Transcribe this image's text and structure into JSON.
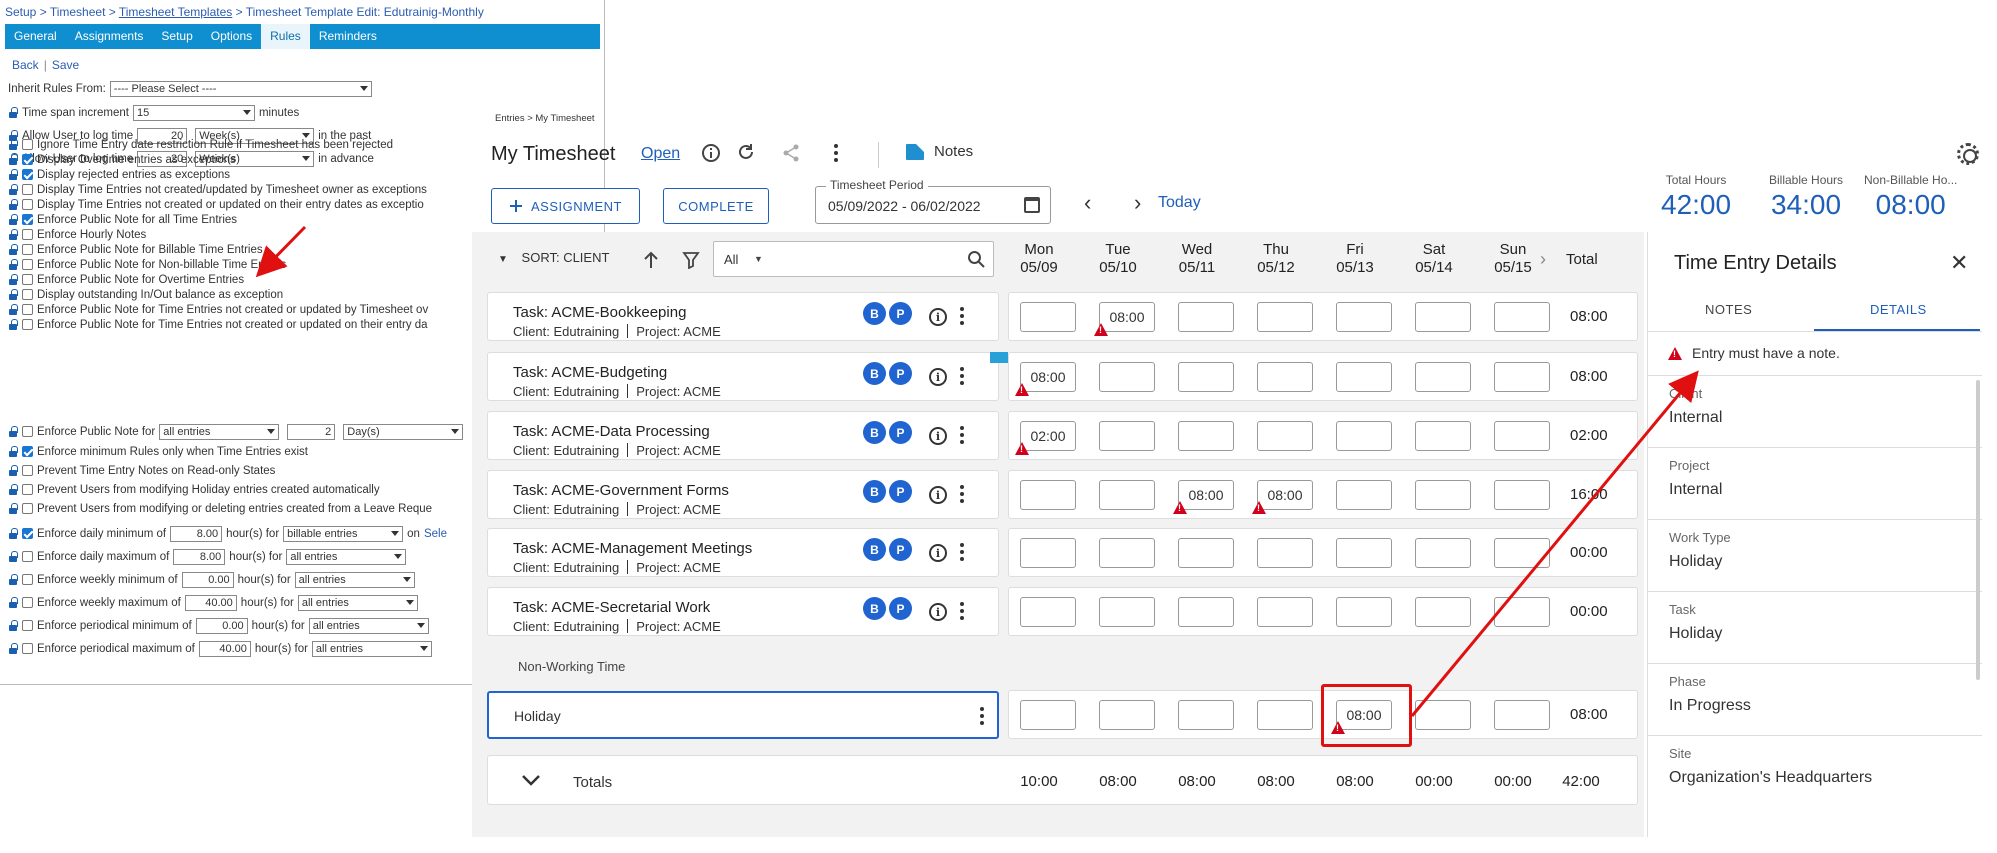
{
  "legacy": {
    "breadcrumb": {
      "setup": "Setup",
      "timesheet": "Timesheet",
      "templates": "Timesheet Templates",
      "edit": "Timesheet Template Edit: Edutrainig-Monthly"
    },
    "tabs": [
      "General",
      "Assignments",
      "Setup",
      "Options",
      "Rules",
      "Reminders"
    ],
    "active_tab": "Rules",
    "back": "Back",
    "save": "Save",
    "inherit_label": "Inherit Rules From:",
    "inherit_value": "---- Please Select ----",
    "span_label": "Time span increment",
    "span_value": "15",
    "span_unit": "minutes",
    "past_label": "Allow User to log time",
    "past_value": "20",
    "past_unit": "Week(s)",
    "past_suffix": "in the past",
    "adv_label": "Allow User to log time",
    "adv_value": "20",
    "adv_unit": "Week(s)",
    "adv_suffix": "in advance",
    "rules": [
      {
        "text": "Ignore Time Entry date restriction Rule if Timesheet has been rejected",
        "checked": false
      },
      {
        "text": "Display Overtime entries as exceptions",
        "checked": true
      },
      {
        "text": "Display rejected entries as exceptions",
        "checked": true
      },
      {
        "text": "Display Time Entries not created/updated by Timesheet owner as exceptions",
        "checked": false
      },
      {
        "text": "Display Time Entries not created or updated on their entry dates as exceptio",
        "checked": false
      },
      {
        "text": "Enforce Public Note for all Time Entries",
        "checked": true
      },
      {
        "text": "Enforce Hourly Notes",
        "checked": false
      },
      {
        "text": "Enforce Public Note for Billable Time Entries",
        "checked": false
      },
      {
        "text": "Enforce Public Note for Non-billable Time Entries",
        "checked": false
      },
      {
        "text": "Enforce Public Note for Overtime Entries",
        "checked": false
      },
      {
        "text": "Display outstanding In/Out balance as exception",
        "checked": false
      },
      {
        "text": "Enforce Public Note for Time Entries not created or updated by Timesheet ov",
        "checked": false
      },
      {
        "text": "Enforce Public Note for Time Entries not created or updated on their entry da",
        "checked": false
      }
    ],
    "note_for_label": "Enforce Public Note for",
    "note_for_value": "all entries",
    "note_for_num": "2",
    "note_for_unit": "Day(s)",
    "rules2": [
      {
        "text": "Enforce minimum Rules only when Time Entries exist",
        "checked": true
      },
      {
        "text": "Prevent Time Entry Notes on Read-only States",
        "checked": false
      },
      {
        "text": "Prevent Users from modifying Holiday entries created automatically",
        "checked": false
      },
      {
        "text": "Prevent Users from modifying or deleting entries created from a Leave Reque",
        "checked": false
      }
    ],
    "limits": [
      {
        "label": "Enforce daily minimum of",
        "value": "8.00",
        "unit": "hour(s) for",
        "sel": "billable entries",
        "checked": true,
        "suffix": "on",
        "link": "Sele"
      },
      {
        "label": "Enforce daily maximum of",
        "value": "8.00",
        "unit": "hour(s) for",
        "sel": "all entries",
        "checked": false,
        "suffix": "",
        "link": ""
      },
      {
        "label": "Enforce weekly minimum of",
        "value": "0.00",
        "unit": "hour(s) for",
        "sel": "all entries",
        "checked": false,
        "suffix": "",
        "link": ""
      },
      {
        "label": "Enforce weekly maximum of",
        "value": "40.00",
        "unit": "hour(s) for",
        "sel": "all entries",
        "checked": false,
        "suffix": "",
        "link": ""
      },
      {
        "label": "Enforce periodical minimum of",
        "value": "0.00",
        "unit": "hour(s) for",
        "sel": "all entries",
        "checked": false,
        "suffix": "",
        "link": ""
      },
      {
        "label": "Enforce periodical maximum of",
        "value": "40.00",
        "unit": "hour(s) for",
        "sel": "all entries",
        "checked": false,
        "suffix": "",
        "link": ""
      }
    ]
  },
  "timesheet": {
    "breadcrumb": "Entries > My Timesheet",
    "title": "My Timesheet",
    "status": "Open",
    "notes": "Notes",
    "assignment_btn": "ASSIGNMENT",
    "complete_btn": "COMPLETE",
    "period_label": "Timesheet Period",
    "period_value": "05/09/2022 - 06/02/2022",
    "today": "Today",
    "stats": [
      {
        "label": "Total Hours",
        "value": "42:00"
      },
      {
        "label": "Billable Hours",
        "value": "34:00"
      },
      {
        "label": "Non-Billable Ho...",
        "value": "08:00"
      }
    ],
    "sort_label": "SORT: CLIENT",
    "filter_value": "All",
    "days": [
      {
        "name": "Mon",
        "date": "05/09"
      },
      {
        "name": "Tue",
        "date": "05/10"
      },
      {
        "name": "Wed",
        "date": "05/11"
      },
      {
        "name": "Thu",
        "date": "05/12"
      },
      {
        "name": "Fri",
        "date": "05/13"
      },
      {
        "name": "Sat",
        "date": "05/14"
      },
      {
        "name": "Sun",
        "date": "05/15"
      }
    ],
    "total_label": "Total",
    "client_prefix": "Client: Edutraining",
    "project_prefix": "Project: ACME",
    "badge_b": "B",
    "badge_p": "P",
    "tasks": [
      {
        "name": "Task: ACME-Bookkeeping",
        "cells": [
          "",
          "08:00",
          "",
          "",
          "",
          "",
          ""
        ],
        "warn": [
          false,
          true,
          false,
          false,
          false,
          false,
          false
        ],
        "total": "08:00"
      },
      {
        "name": "Task: ACME-Budgeting",
        "cells": [
          "08:00",
          "",
          "",
          "",
          "",
          "",
          ""
        ],
        "warn": [
          true,
          false,
          false,
          false,
          false,
          false,
          false
        ],
        "total": "08:00"
      },
      {
        "name": "Task: ACME-Data Processing",
        "cells": [
          "02:00",
          "",
          "",
          "",
          "",
          "",
          ""
        ],
        "warn": [
          true,
          false,
          false,
          false,
          false,
          false,
          false
        ],
        "total": "02:00"
      },
      {
        "name": "Task: ACME-Government Forms",
        "cells": [
          "",
          "",
          "08:00",
          "08:00",
          "",
          "",
          ""
        ],
        "warn": [
          false,
          false,
          true,
          true,
          false,
          false,
          false
        ],
        "total": "16:00"
      },
      {
        "name": "Task: ACME-Management Meetings",
        "cells": [
          "",
          "",
          "",
          "",
          "",
          "",
          ""
        ],
        "warn": [
          false,
          false,
          false,
          false,
          false,
          false,
          false
        ],
        "total": "00:00"
      },
      {
        "name": "Task: ACME-Secretarial Work",
        "cells": [
          "",
          "",
          "",
          "",
          "",
          "",
          ""
        ],
        "warn": [
          false,
          false,
          false,
          false,
          false,
          false,
          false
        ],
        "total": "00:00"
      }
    ],
    "non_working": "Non-Working Time",
    "holiday": {
      "name": "Holiday",
      "cells": [
        "",
        "",
        "",
        "",
        "08:00",
        "",
        ""
      ],
      "warn": [
        false,
        false,
        false,
        false,
        true,
        false,
        false
      ],
      "total": "08:00"
    },
    "totals_label": "Totals",
    "totals": [
      "10:00",
      "08:00",
      "08:00",
      "08:00",
      "08:00",
      "00:00",
      "00:00"
    ],
    "grand_total": "42:00"
  },
  "panel": {
    "title": "Time Entry Details",
    "tab_notes": "NOTES",
    "tab_details": "DETAILS",
    "error": "Entry must have a note.",
    "fields": [
      {
        "label": "Client",
        "value": "Internal"
      },
      {
        "label": "Project",
        "value": "Internal"
      },
      {
        "label": "Work Type",
        "value": "Holiday"
      },
      {
        "label": "Task",
        "value": "Holiday"
      },
      {
        "label": "Phase",
        "value": "In Progress"
      },
      {
        "label": "Site",
        "value": "Organization's Headquarters"
      }
    ]
  },
  "colors": {
    "accent": "#1f5fb8",
    "tab_bar": "#0f8fd0",
    "warning": "#d0021b",
    "annotation": "#e01010"
  }
}
